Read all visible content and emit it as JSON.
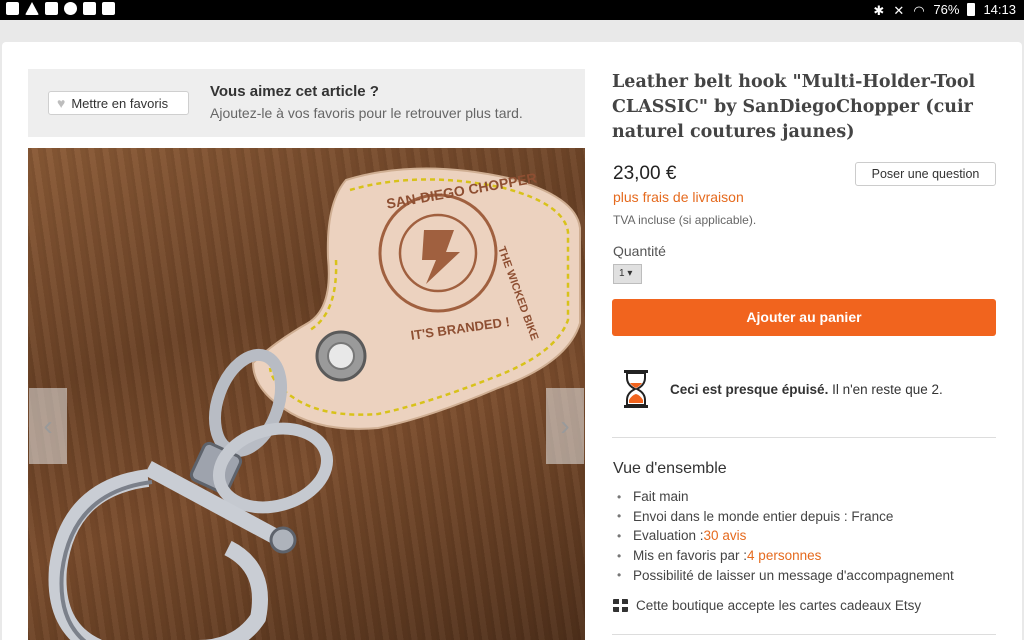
{
  "status_bar": {
    "battery": "76%",
    "time": "14:13"
  },
  "favorites_banner": {
    "button_label": "Mettre en favoris",
    "title": "Vous aimez cet article ?",
    "subtitle": "Ajoutez-le à vos favoris pour le retrouver plus tard."
  },
  "product": {
    "title": "Leather belt hook \"Multi-Holder-Tool CLASSIC\" by SanDiegoChopper (cuir naturel coutures jaunes)",
    "price": "23,00 €",
    "question_button": "Poser une question",
    "shipping": "plus frais de livraison",
    "vat": "TVA incluse (si applicable).",
    "quantity_label": "Quantité",
    "quantity_value": "1",
    "add_to_cart": "Ajouter au panier",
    "stock_bold": "Ceci est presque épuisé.",
    "stock_rest": " Il n'en reste que 2."
  },
  "overview": {
    "title": "Vue d'ensemble",
    "items": [
      {
        "text": "Fait main",
        "link": ""
      },
      {
        "text": "Envoi dans le monde entier depuis : France",
        "link": ""
      },
      {
        "text": "Evaluation : ",
        "link": "30 avis"
      },
      {
        "text": "Mis en favoris par : ",
        "link": "4 personnes"
      },
      {
        "text": "Possibilité de laisser un message d'accompagnement",
        "link": ""
      }
    ],
    "gift_cards": "Cette boutique accepte les cartes cadeaux Etsy"
  },
  "image": {
    "stamp_top": "SAN-DIEGO CHOPPER",
    "stamp_side": "THE WICKED BIKE",
    "stamp_bottom": "IT'S BRANDED !"
  },
  "colors": {
    "accent": "#f1641e",
    "link": "#e56a1e"
  }
}
